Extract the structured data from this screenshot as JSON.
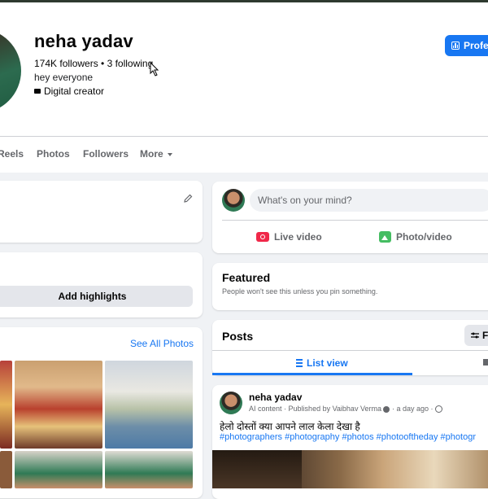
{
  "profile": {
    "name": "neha yadav",
    "stats": "174K followers • 3 following",
    "bio": "hey everyone",
    "category": "Digital creator",
    "professional_label": "Profe"
  },
  "tabs": [
    "Reels",
    "Photos",
    "Followers",
    "More"
  ],
  "left": {
    "highlights_label": "Add highlights",
    "photos_link": "See All Photos"
  },
  "composer": {
    "placeholder": "What's on your mind?",
    "live_label": "Live video",
    "photo_label": "Photo/video"
  },
  "featured": {
    "title": "Featured",
    "subtitle": "People won't see this unless you pin something."
  },
  "posts": {
    "title": "Posts",
    "filter_label": "F",
    "list_view_label": "List view"
  },
  "post": {
    "author": "neha yadav",
    "ai_content": "AI content",
    "published_by": "Published by Vaibhav Verma",
    "time": "a day ago",
    "text": "हेलो दोस्तों क्या आपने लाल केला देखा है",
    "hashtags": "#photographers #photography #photos #photooftheday #photogr"
  },
  "colors": {
    "accent": "#1877f2",
    "background": "#f0f2f5",
    "live": "#f02849",
    "photo": "#45bd62"
  }
}
